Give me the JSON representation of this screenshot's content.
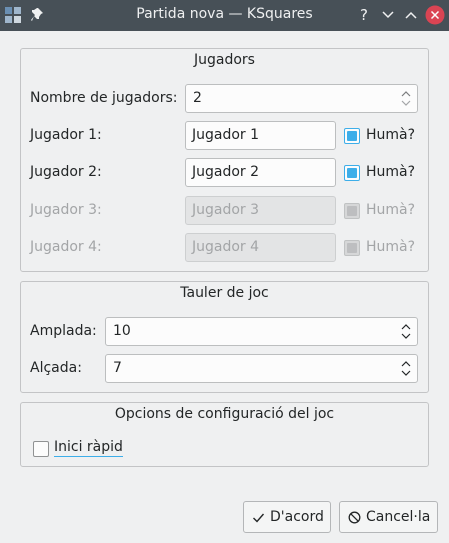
{
  "window": {
    "title": "Partida nova — KSquares",
    "controls": {
      "help": "?",
      "minimize": "chevron-down",
      "maximize": "chevron-up",
      "close": "close"
    }
  },
  "players_group": {
    "title": "Jugadors",
    "count_label": "Nombre de jugadors:",
    "count_value": "2",
    "players": [
      {
        "label": "Jugador 1:",
        "name": "Jugador 1",
        "human_label": "Humà?",
        "human": true,
        "enabled": true
      },
      {
        "label": "Jugador 2:",
        "name": "Jugador 2",
        "human_label": "Humà?",
        "human": true,
        "enabled": true
      },
      {
        "label": "Jugador 3:",
        "name": "Jugador 3",
        "human_label": "Humà?",
        "human": false,
        "enabled": false
      },
      {
        "label": "Jugador 4:",
        "name": "Jugador 4",
        "human_label": "Humà?",
        "human": false,
        "enabled": false
      }
    ]
  },
  "board_group": {
    "title": "Tauler de joc",
    "width_label": "Amplada:",
    "width_value": "10",
    "height_label": "Alçada:",
    "height_value": "7"
  },
  "options_group": {
    "title": "Opcions de configuració del joc",
    "quick_start_label": "Inici ràpid",
    "quick_start_checked": false
  },
  "buttons": {
    "ok_label": "D'acord",
    "cancel_label": "Cancel·la"
  },
  "colors": {
    "titlebar": "#475057",
    "accent": "#3daee9",
    "close_button": "#da4453",
    "window_bg": "#eff0f1"
  }
}
